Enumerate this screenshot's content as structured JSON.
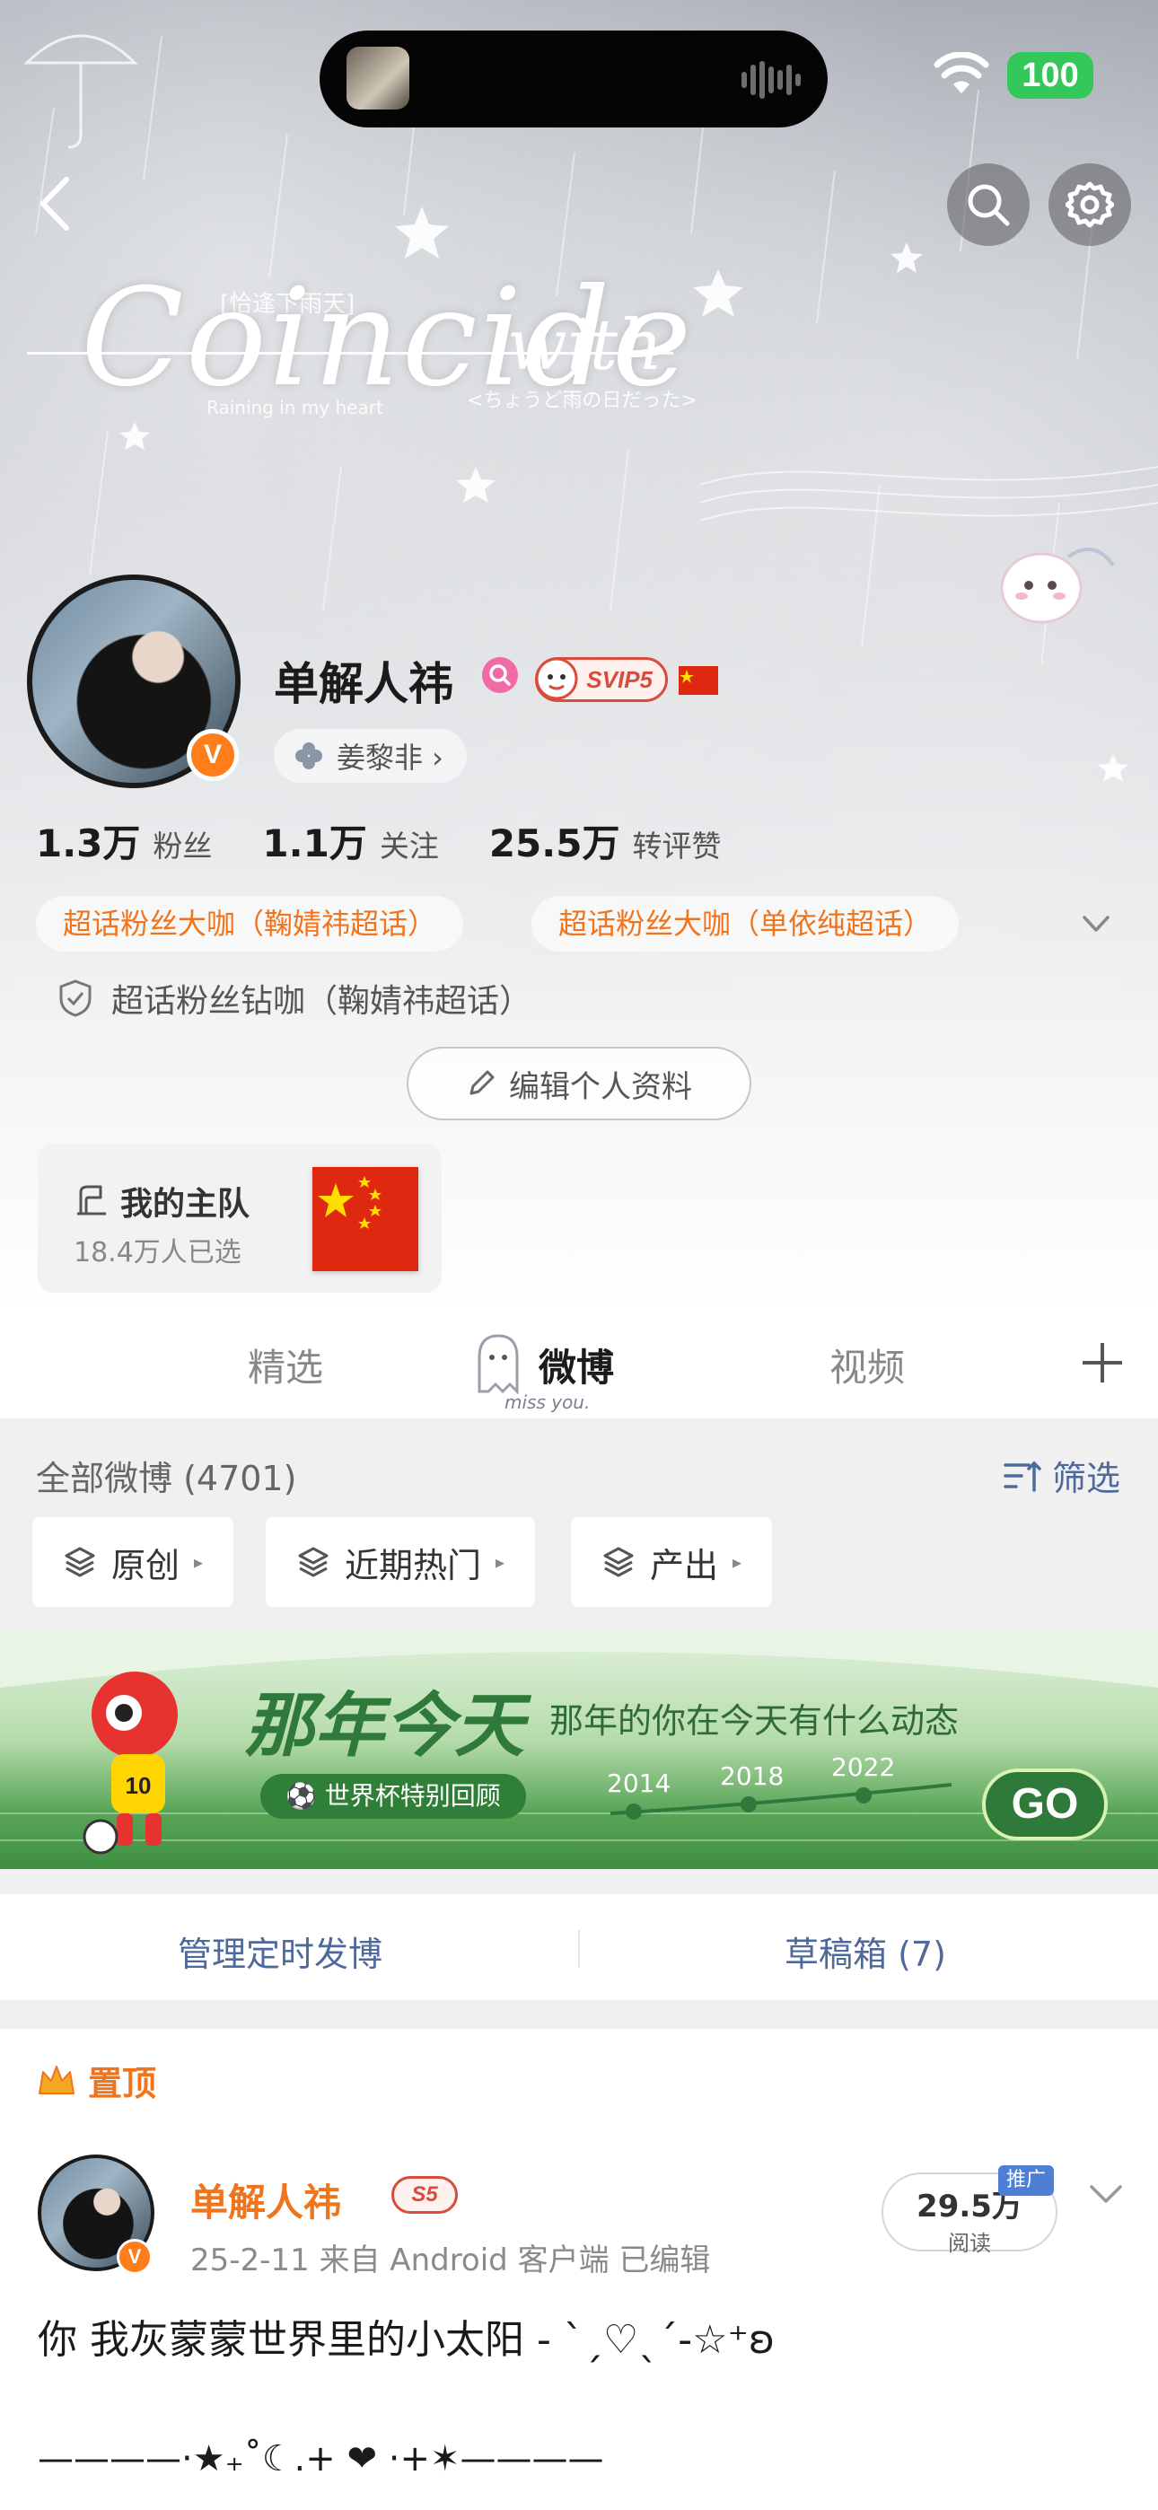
{
  "status_bar": {
    "battery": "100"
  },
  "banner": {
    "top_caption": "[恰逢下雨天]",
    "title": "Coincide",
    "title_suffix": "with",
    "subtitle": "Raining in my heart",
    "jp_caption": "<ちょうど雨の日だった>"
  },
  "profile": {
    "username": "单解人祎",
    "svip_label": "SVIP5",
    "verified_mark": "V",
    "fan_group": "姜黎非 ›",
    "stats": [
      {
        "value": "1.3万",
        "label": "粉丝"
      },
      {
        "value": "1.1万",
        "label": "关注"
      },
      {
        "value": "25.5万",
        "label": "转评赞"
      }
    ],
    "tags": [
      "超话粉丝大咖（鞠婧祎超话）",
      "超话粉丝大咖（单依纯超话）"
    ],
    "diamond_tag": "超话粉丝钻咖（鞠婧祎超话）",
    "edit_button": "编辑个人资料",
    "team": {
      "title": "我的主队",
      "subtitle": "18.4万人已选"
    }
  },
  "tabs": {
    "items": [
      "精选",
      "微博",
      "视频"
    ],
    "active": "微博",
    "caption": "miss you."
  },
  "filters": {
    "all_label": "全部微博 (4701)",
    "screen_label": "筛选",
    "chips": [
      "原创",
      "近期热门",
      "产出"
    ]
  },
  "promo": {
    "title": "那年今天",
    "subtitle": "那年的你在今天有什么动态",
    "pill": "世界杯特别回顾",
    "years": [
      "2014",
      "2018",
      "2022"
    ],
    "go": "GO",
    "jersey_number": "10"
  },
  "manage": {
    "scheduled": "管理定时发博",
    "drafts": "草稿箱 (7)"
  },
  "post": {
    "pinned_label": "置顶",
    "author": "单解人祎",
    "level_badge": "S5",
    "meta": "25-2-11  来自 Android 客户端  已编辑",
    "reads": "29.5万",
    "reads_label": "阅读",
    "promote": "推广",
    "text": "你 我灰蒙蒙世界里的小太阳 - ˋˏ♡ˎˊ-☆⁺ʚ",
    "decoration": "————·★₊˚☾.+ ❤ ·+✶————"
  },
  "colors": {
    "accent_orange": "#f0741c",
    "link_blue": "#4e6a9c",
    "svip_red": "#d94b3b",
    "battery_green": "#34c759"
  }
}
